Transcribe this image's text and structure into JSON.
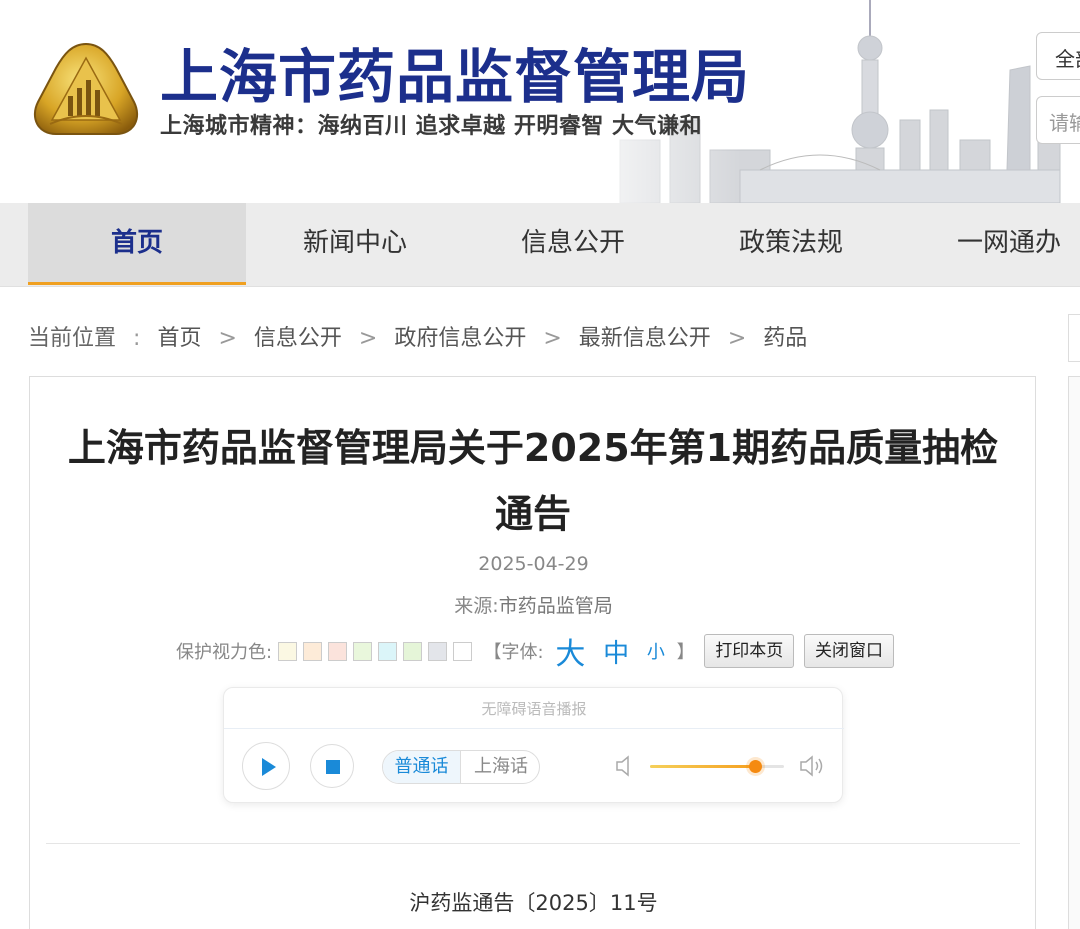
{
  "header": {
    "site_title": "上海市药品监督管理局",
    "slogan": "上海城市精神：海纳百川  追求卓越  开明睿智  大气谦和",
    "scope_button": "全部",
    "search_placeholder": "请输"
  },
  "nav": {
    "items": [
      {
        "label": "首页",
        "active": true
      },
      {
        "label": "新闻中心"
      },
      {
        "label": "信息公开"
      },
      {
        "label": "政策法规"
      },
      {
        "label": "一网通办"
      }
    ]
  },
  "breadcrumb": {
    "prefix": "当前位置",
    "colon": ":",
    "separator": ">",
    "items": [
      "首页",
      "信息公开",
      "政府信息公开",
      "最新信息公开",
      "药品"
    ]
  },
  "article": {
    "title": "上海市药品监督管理局关于2025年第1期药品质量抽检通告",
    "date": "2025-04-29",
    "source_label": "来源:",
    "source_value": "市药品监管局",
    "doc_number": "沪药监通告〔2025〕11号"
  },
  "tools": {
    "eye_color_label": "保护视力色:",
    "swatches": [
      "#fbf8e3",
      "#fdebd8",
      "#fbe3dc",
      "#e9f7dc",
      "#dbf5f9",
      "#e5f5d8",
      "#e3e5ea",
      "#ffffff"
    ],
    "font_label": "【字体:",
    "font_big": "大",
    "font_mid": "中",
    "font_small": "小",
    "font_close": "】",
    "print_button": "打印本页",
    "close_button": "关闭窗口"
  },
  "player": {
    "label": "无障碍语音播报",
    "lang_selected": "普通话",
    "lang_other": "上海话",
    "volume": 0.78,
    "accent_color": "#1a8ad8"
  },
  "colors": {
    "brand_blue": "#1c2f8c",
    "nav_active_underline": "#f0a020"
  }
}
